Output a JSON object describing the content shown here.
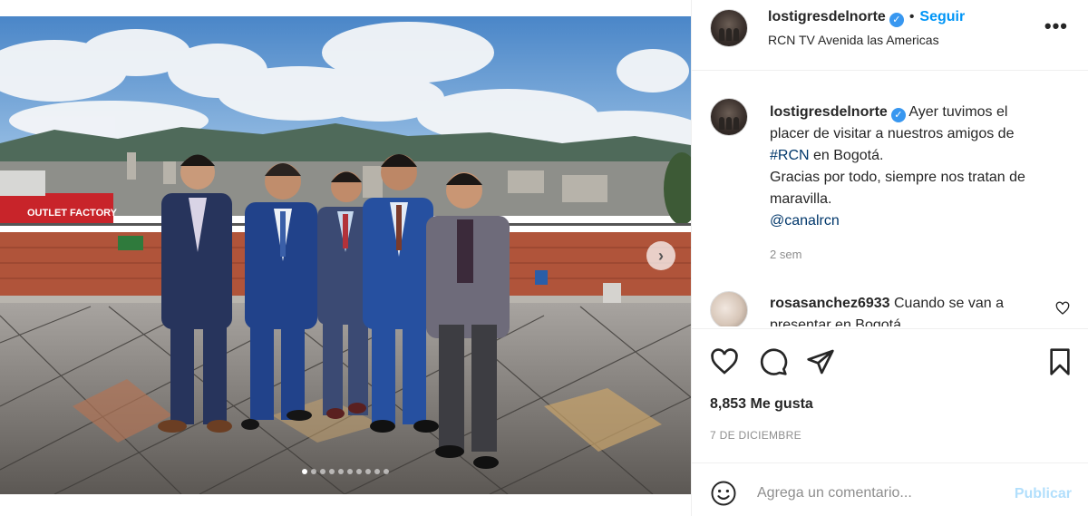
{
  "post": {
    "username": "lostigresdelnorte",
    "verified_icon": "verified-badge-icon",
    "follow_label": "Seguir",
    "bullet": "•",
    "location": "RCN TV Avenida las Americas",
    "more_icon": "more-options-icon",
    "more_label": "•••"
  },
  "caption": {
    "username": "lostigresdelnorte",
    "line1": "Ayer tuvimos el",
    "line2": "placer de visitar a nuestros amigos de",
    "hashtag": "#RCN",
    "line3_rest": " en Bogotá.",
    "line4": "Gracias por todo, siempre nos tratan de",
    "line5": "maravilla.",
    "mention": "@canalrcn",
    "time": "2 sem"
  },
  "comment": {
    "username": "rosasanchez6933",
    "text": "Cuando se van a presentar en Bogotá"
  },
  "actions": {
    "like_icon": "heart-icon",
    "comment_icon": "comment-bubble-icon",
    "share_icon": "send-paper-plane-icon",
    "save_icon": "bookmark-icon",
    "likes": "8,853 Me gusta",
    "date": "7 DE DICIEMBRE"
  },
  "add_comment": {
    "emoji_icon": "emoji-face-icon",
    "placeholder": "Agrega un comentario...",
    "publish_label": "Publicar"
  },
  "carousel": {
    "next_label": "›",
    "slide_count": 10,
    "active_index": 0
  },
  "colors": {
    "link": "#0095f6",
    "verified": "#3897f0",
    "publish_disabled": "#b2dffc",
    "muted": "#8e8e8e"
  }
}
